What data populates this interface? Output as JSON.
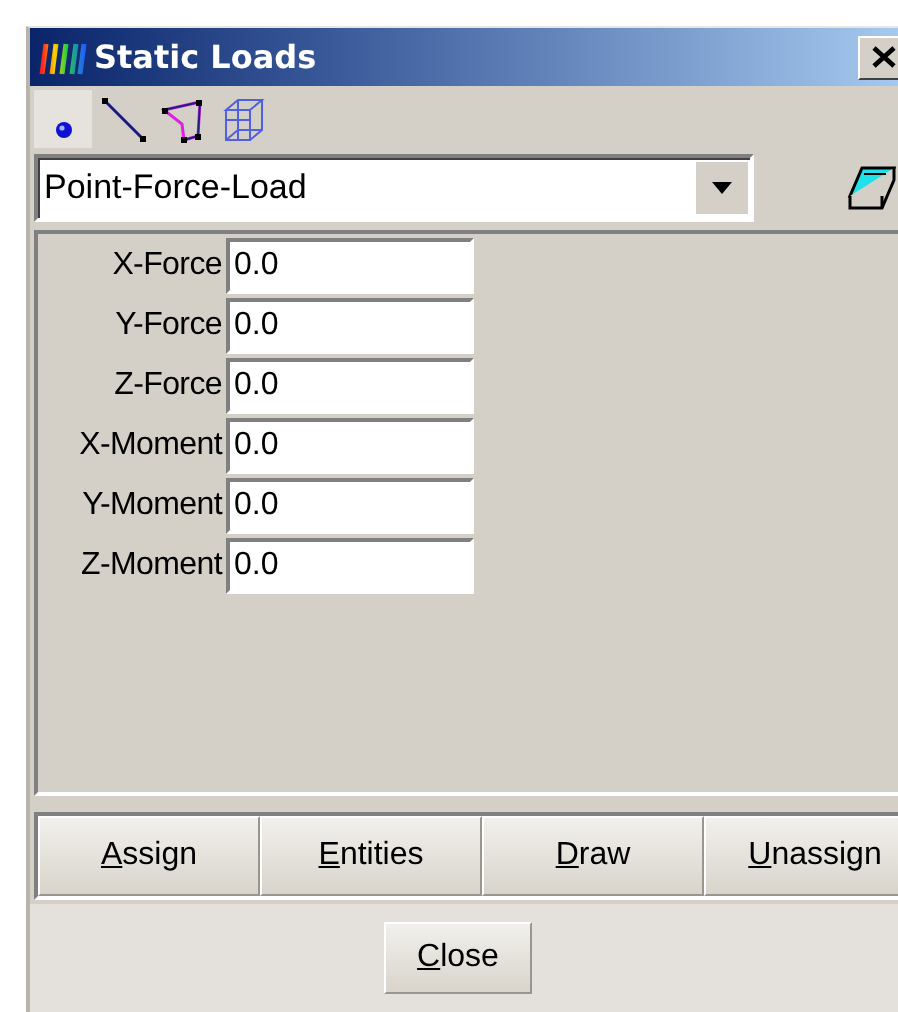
{
  "window": {
    "title": "Static Loads"
  },
  "tools": [
    {
      "kind": "point",
      "selected": true
    },
    {
      "kind": "line",
      "selected": false
    },
    {
      "kind": "surface",
      "selected": false
    },
    {
      "kind": "volume",
      "selected": false
    }
  ],
  "load_type": {
    "value": "Point-Force-Load"
  },
  "fields": [
    {
      "label": "X-Force",
      "value": "0.0"
    },
    {
      "label": "Y-Force",
      "value": "0.0"
    },
    {
      "label": "Z-Force",
      "value": "0.0"
    },
    {
      "label": "X-Moment",
      "value": "0.0"
    },
    {
      "label": "Y-Moment",
      "value": "0.0"
    },
    {
      "label": "Z-Moment",
      "value": "0.0"
    }
  ],
  "actions": [
    "Assign",
    "Entities",
    "Draw",
    "Unassign"
  ],
  "close_button": "Close"
}
